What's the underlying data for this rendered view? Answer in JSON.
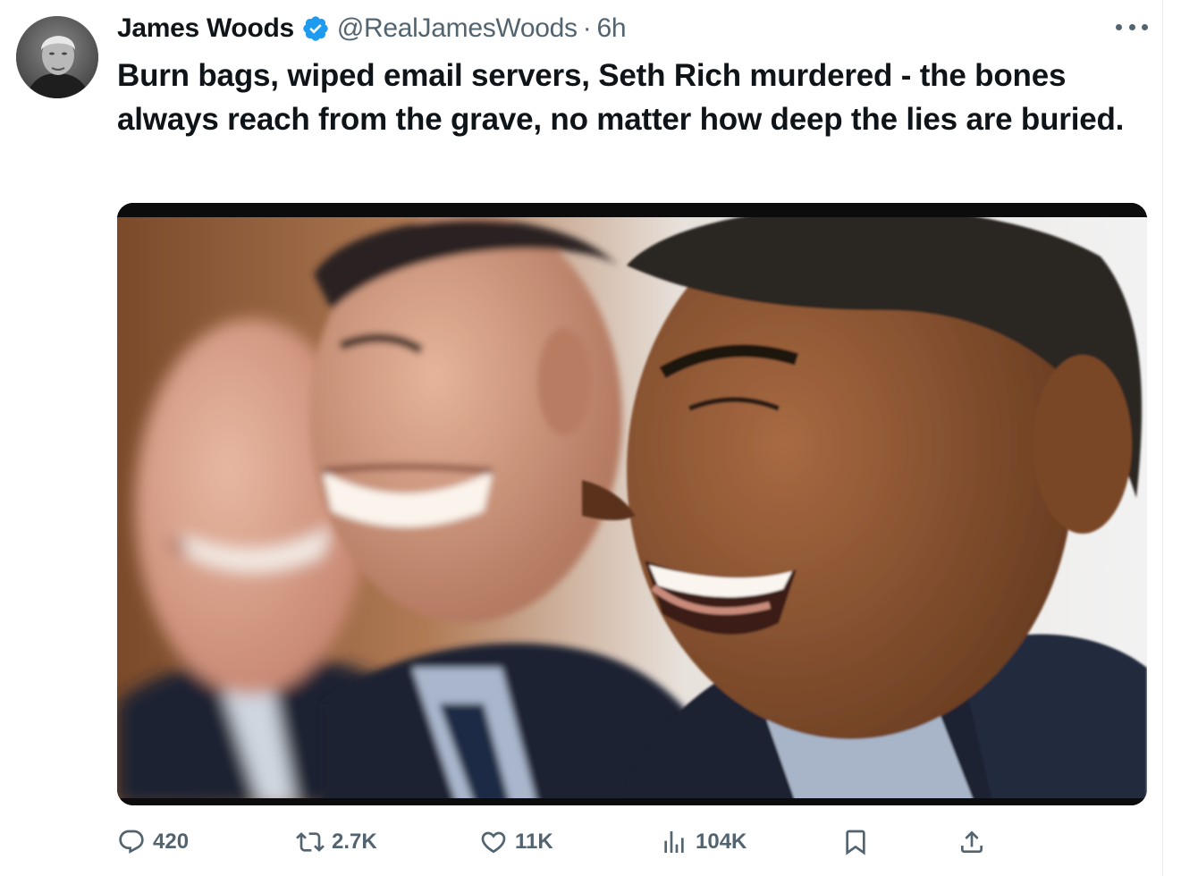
{
  "author": {
    "name": "James Woods",
    "handle": "@RealJamesWoods",
    "separator": "·",
    "time": "6h",
    "verified_color": "#1d9bf0"
  },
  "tweet": {
    "text": "Burn bags, wiped email servers, Seth Rich murdered - the bones always reach from the grave, no matter how deep the lies are buried."
  },
  "media": {
    "description": "three-men-laughing-photo"
  },
  "actions": {
    "replies": "420",
    "reposts": "2.7K",
    "likes": "11K",
    "views": "104K"
  },
  "icons": {
    "reply": "reply-icon",
    "repost": "repost-icon",
    "like": "heart-icon",
    "views": "views-icon",
    "bookmark": "bookmark-icon",
    "share": "share-icon",
    "more": "more-icon",
    "verified": "verified-badge-icon"
  },
  "colors": {
    "text": "#0f1419",
    "secondary": "#536471",
    "accent": "#1d9bf0"
  }
}
